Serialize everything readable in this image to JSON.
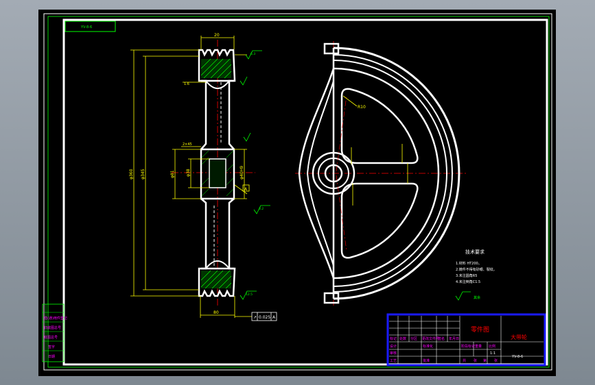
{
  "drawing": {
    "title_label": "零件图",
    "part_name": "大带轮",
    "drawing_number_small": "YV-8-6",
    "header_code": "YV-8-6",
    "title_row_labels": [
      "标记",
      "处数",
      "分区",
      "更改文件号",
      "签名",
      "年月日"
    ],
    "title_mid_labels": [
      "阶段标记",
      "重量",
      "比例"
    ],
    "scale_value": "1:1",
    "design_labels": [
      "设计",
      "标准化"
    ],
    "approval_labels": [
      "审核",
      "工艺",
      "批准"
    ],
    "footer_labels": [
      "共",
      "张",
      "第",
      "张"
    ],
    "left_stamp_rows": [
      "借(通)用件登记",
      "旧底图总号",
      "底图总号",
      "签字",
      "日期"
    ]
  },
  "dimensions": {
    "top_width": "20",
    "bottom_width": "80",
    "diameter_outer": "φ360",
    "diameter_pitch": "φ345",
    "diameter_hub": "φ81",
    "diameter_bore": "φ38",
    "hub_key": "φ40H9",
    "chamfer_top": "1.6",
    "chamfer_mid": "2×45",
    "radius_label": "R10",
    "datum": "A",
    "tolerance_box": "0.025",
    "tolerance_ref": "A",
    "roughness_1": "6.3",
    "roughness_2": "3.2",
    "roughness_3": "12.5"
  },
  "tech_notes": {
    "heading": "技术要求",
    "lines": [
      "1.材料 HT200。",
      "2.铸件不得有砂眼、裂纹。",
      "3.未注圆角R5",
      "4.未注倒角C1.5"
    ],
    "extra_symbol": "其余"
  },
  "colors": {
    "frame": "#ffffff",
    "inner_frame": "#00ff00",
    "dim": "#ffff00",
    "center": "#ff0000",
    "hatch": "#00ff00",
    "title_border": "#1a1aff",
    "title_text": "#ff00ff",
    "title_red": "#ff0000"
  }
}
